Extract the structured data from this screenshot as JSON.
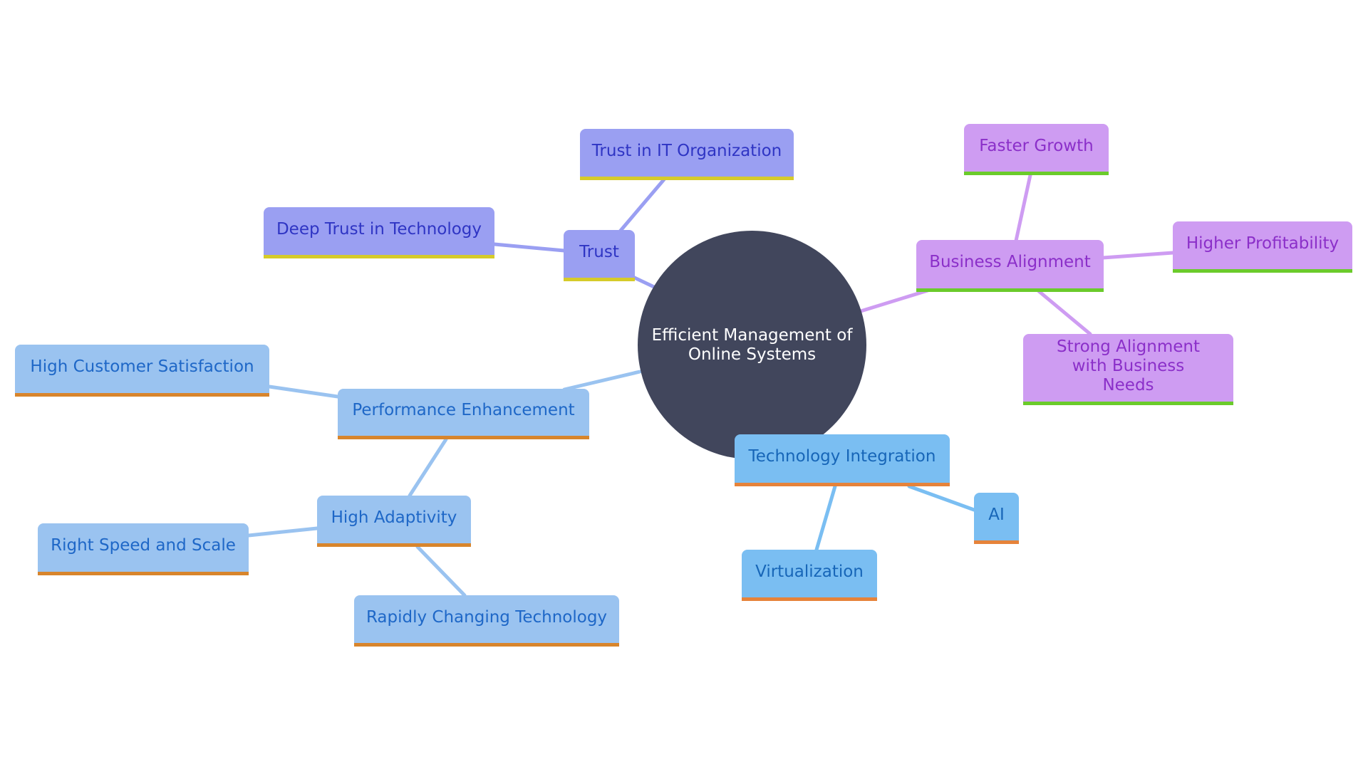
{
  "diagram": {
    "type": "mindmap",
    "root": "Efficient Management of Online Systems",
    "branches": {
      "trust": {
        "label": "Trust",
        "children": [
          "Trust in IT Organization",
          "Deep Trust in Technology"
        ],
        "colors": {
          "fill": "#9a9ff2",
          "text": "#2f35c4",
          "underline": "#d6cb2a"
        }
      },
      "business": {
        "label": "Business Alignment",
        "children": [
          "Faster Growth",
          "Higher Profitability",
          "Strong Alignment with Business Needs"
        ],
        "colors": {
          "fill": "#ce9cf2",
          "text": "#8b2fc9",
          "underline": "#6bcb2b"
        }
      },
      "performance": {
        "label": "Performance Enhancement",
        "children": [
          "High Customer Satisfaction",
          "High Adaptivity"
        ],
        "sub": {
          "label": "High Adaptivity",
          "children": [
            "Right Speed and Scale",
            "Rapidly Changing Technology"
          ]
        },
        "colors": {
          "fill": "#9ac3f0",
          "text": "#1e67c7",
          "underline": "#d8852c"
        }
      },
      "technology": {
        "label": "Technology Integration",
        "children": [
          "Virtualization",
          "AI"
        ],
        "colors": {
          "fill": "#7abef2",
          "text": "#1766b8",
          "underline": "#e6833a"
        }
      }
    },
    "root_color": "#41465c"
  }
}
